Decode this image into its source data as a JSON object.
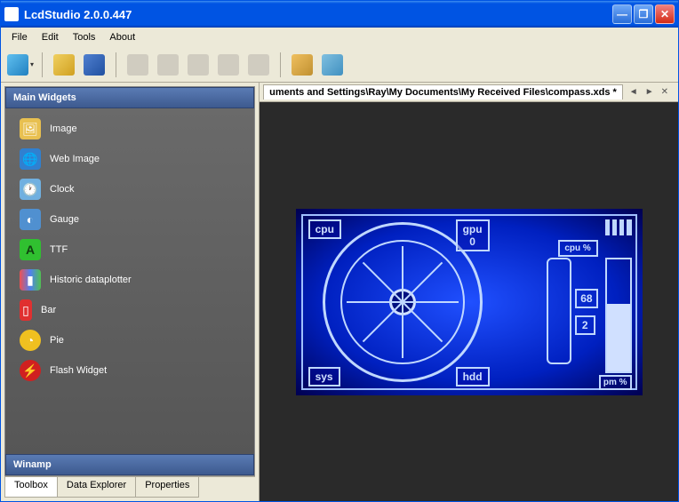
{
  "window": {
    "title": "LcdStudio 2.0.0.447"
  },
  "menu": {
    "file": "File",
    "edit": "Edit",
    "tools": "Tools",
    "about": "About"
  },
  "toolbar": {
    "new": "new",
    "open": "open",
    "save": "save",
    "cut": "cut",
    "copy": "copy",
    "paste": "paste",
    "undo": "undo",
    "redo": "redo",
    "settings": "settings",
    "monitor": "monitor"
  },
  "toolbox": {
    "category_main": "Main Widgets",
    "category_winamp": "Winamp",
    "widgets": [
      {
        "label": "Image",
        "icon": "image",
        "color": "#e8c050"
      },
      {
        "label": "Web Image",
        "icon": "web-image",
        "color": "#3080d0"
      },
      {
        "label": "Clock",
        "icon": "clock",
        "color": "#70b0e0"
      },
      {
        "label": "Gauge",
        "icon": "gauge",
        "color": "#5090d0"
      },
      {
        "label": "TTF",
        "icon": "ttf",
        "color": "#30c030"
      },
      {
        "label": "Historic dataplotter",
        "icon": "plotter",
        "color": "#f05050"
      },
      {
        "label": "Bar",
        "icon": "bar",
        "color": "#e03030"
      },
      {
        "label": "Pie",
        "icon": "pie",
        "color": "#f0c020"
      },
      {
        "label": "Flash Widget",
        "icon": "flash",
        "color": "#d02020"
      }
    ]
  },
  "tabs": {
    "toolbox": "Toolbox",
    "data_explorer": "Data Explorer",
    "properties": "Properties"
  },
  "document": {
    "path": "uments and Settings\\Ray\\My Documents\\My Received Files\\compass.xds *"
  },
  "lcd": {
    "labels": {
      "cpu": "cpu",
      "gpu": "gpu",
      "gpu_val": "0",
      "sys": "sys",
      "hdd": "hdd",
      "cpu_pct": "cpu %",
      "pm_pct": "pm %"
    },
    "values": {
      "v1": "68",
      "v2": "2"
    }
  }
}
